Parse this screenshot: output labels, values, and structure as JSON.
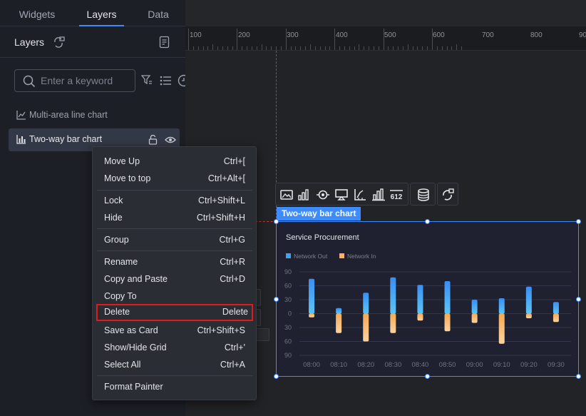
{
  "tabs": [
    {
      "label": "Widgets",
      "active": false
    },
    {
      "label": "Layers",
      "active": true
    },
    {
      "label": "Data",
      "active": false
    }
  ],
  "panel": {
    "title": "Layers"
  },
  "search": {
    "placeholder": "Enter a keyword",
    "value": ""
  },
  "layers": [
    {
      "label": "Multi-area line chart",
      "icon": "line-chart-icon",
      "selected": false
    },
    {
      "label": "Two-way bar chart",
      "icon": "bar-chart-icon",
      "selected": true
    }
  ],
  "ruler": {
    "labels": [
      "100",
      "200",
      "300",
      "400",
      "500",
      "600",
      "700",
      "800",
      "90"
    ]
  },
  "canvas": {
    "selected_name": "Two-way bar chart"
  },
  "context_menu": {
    "items": [
      {
        "label": "Move Up",
        "shortcut": "Ctrl+["
      },
      {
        "label": "Move to top",
        "shortcut": "Ctrl+Alt+["
      },
      {
        "label": "Lock",
        "shortcut": "Ctrl+Shift+L"
      },
      {
        "label": "Hide",
        "shortcut": "Ctrl+Shift+H"
      },
      {
        "label": "Group",
        "shortcut": "Ctrl+G"
      },
      {
        "label": "Rename",
        "shortcut": "Ctrl+R"
      },
      {
        "label": "Copy and Paste",
        "shortcut": "Ctrl+D"
      },
      {
        "label": "Copy To",
        "shortcut": ""
      },
      {
        "label": "Delete",
        "shortcut": "Delete",
        "highlighted": true
      },
      {
        "label": "Save as Card",
        "shortcut": "Ctrl+Shift+S"
      },
      {
        "label": "Show/Hide Grid",
        "shortcut": "Ctrl+'"
      },
      {
        "label": "Select All",
        "shortcut": "Ctrl+A"
      },
      {
        "label": "Format Painter",
        "shortcut": ""
      }
    ]
  },
  "colors": {
    "accent": "#3d8bfd",
    "highlight_border": "#e11b1b",
    "series_out": "#3ba4f5",
    "series_in": "#f7b26a"
  },
  "chart_data": {
    "type": "bar",
    "title": "Service Procurement",
    "categories": [
      "08:00",
      "08:10",
      "08:20",
      "08:30",
      "08:40",
      "08:50",
      "09:00",
      "09:10",
      "09:20",
      "09:30"
    ],
    "series": [
      {
        "name": "Network Out",
        "values": [
          75,
          12,
          45,
          78,
          62,
          70,
          30,
          33,
          58,
          25
        ]
      },
      {
        "name": "Network In",
        "values": [
          -8,
          -42,
          -60,
          -42,
          -15,
          -38,
          -20,
          -65,
          -10,
          -18
        ]
      }
    ],
    "ylim": [
      -90,
      90
    ],
    "yticks": [
      "90",
      "60",
      "30",
      "0",
      "30",
      "60",
      "90"
    ],
    "legend": "top-left",
    "grid": true
  }
}
